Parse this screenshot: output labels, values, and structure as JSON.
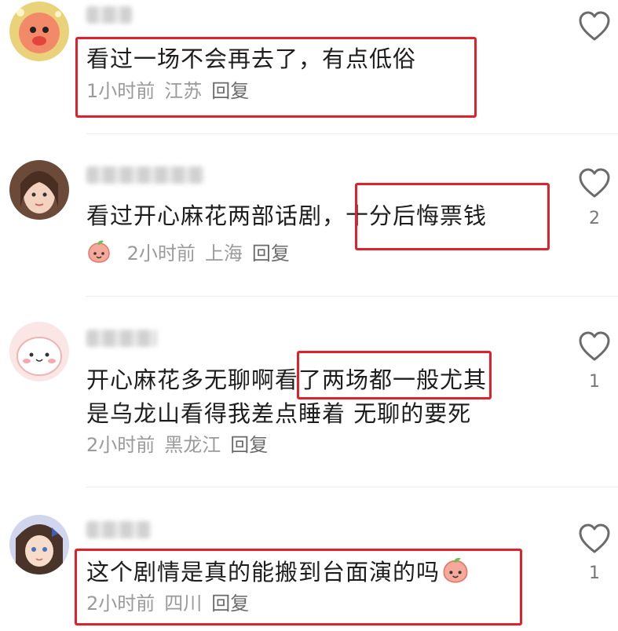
{
  "comments": [
    {
      "text": "看过一场不会再去了，有点低俗",
      "time": "1小时前",
      "location": "江苏",
      "reply": "回复",
      "likes": ""
    },
    {
      "text_part1": "看过开心麻花两部话剧，",
      "text_part2": "十分后悔票钱",
      "time": "2小时前",
      "location": "上海",
      "reply": "回复",
      "likes": "2"
    },
    {
      "line1_part1": "开心麻花多无聊啊",
      "line1_part2": "看了两场都一般",
      "line1_part3": "尤其",
      "line2": "是乌龙山看得我差点睡着 无聊的要死",
      "time": "2小时前",
      "location": "黑龙江",
      "reply": "回复",
      "likes": "1"
    },
    {
      "text": "这个剧情是真的能搬到台面演的吗",
      "time": "2小时前",
      "location": "四川",
      "reply": "回复",
      "likes": "1"
    }
  ],
  "icons": {
    "like": "heart-outline-icon",
    "emoji": "peach-emoji-icon"
  },
  "colors": {
    "highlight": "#e0202a",
    "meta": "#9a9a9a",
    "text": "#1d1d1d"
  }
}
